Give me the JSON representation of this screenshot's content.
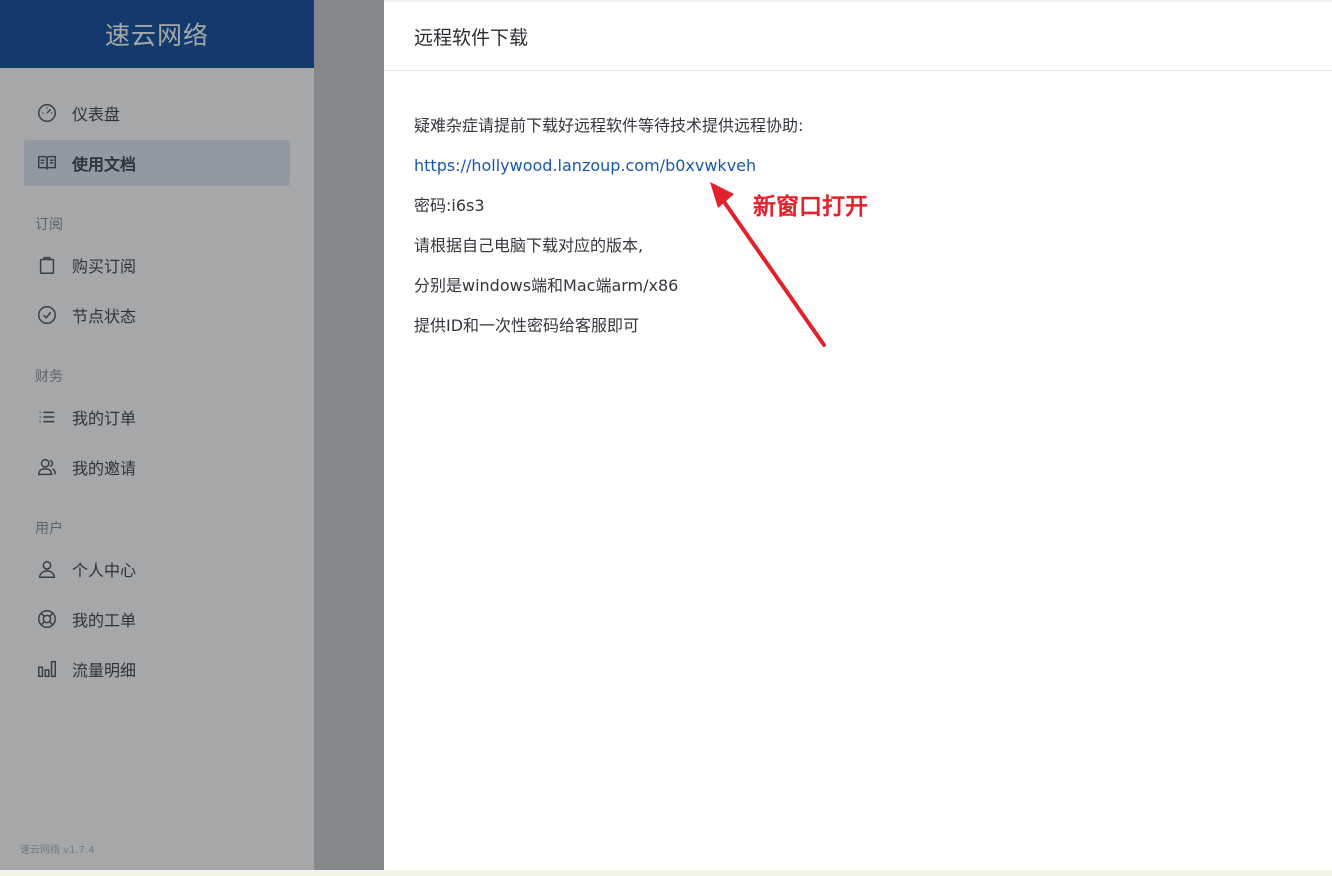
{
  "brand": {
    "title": "速云网络"
  },
  "sidebar": {
    "primary": [
      {
        "label": "仪表盘",
        "icon": "dashboard-icon"
      },
      {
        "label": "使用文档",
        "icon": "book-icon"
      }
    ],
    "sections": [
      {
        "label": "订阅",
        "items": [
          {
            "label": "购买订阅",
            "icon": "bag-icon"
          },
          {
            "label": "节点状态",
            "icon": "check-circle-icon"
          }
        ]
      },
      {
        "label": "财务",
        "items": [
          {
            "label": "我的订单",
            "icon": "list-icon"
          },
          {
            "label": "我的邀请",
            "icon": "users-icon"
          }
        ]
      },
      {
        "label": "用户",
        "items": [
          {
            "label": "个人中心",
            "icon": "user-icon"
          },
          {
            "label": "我的工单",
            "icon": "lifebuoy-icon"
          },
          {
            "label": "流量明细",
            "icon": "bar-chart-icon"
          }
        ]
      }
    ],
    "version": "速云网络 v1.7.4"
  },
  "panel": {
    "title": "远程软件下载",
    "intro": "疑难杂症请提前下载好远程软件等待技术提供远程协助:",
    "link": "https://hollywood.lanzoup.com/b0xvwkveh",
    "password": "密码:i6s3",
    "line_version": "请根据自己电脑下载对应的版本,",
    "line_platforms": "分别是windows端和Mac端arm/x86",
    "line_id": "提供ID和一次性密码给客服即可"
  },
  "annotation": {
    "text": "新窗口打开",
    "color": "#e2212a"
  },
  "colors": {
    "brand": "#0d4a9a",
    "link": "#1a56b0",
    "active_bg": "#dfe8f6"
  }
}
